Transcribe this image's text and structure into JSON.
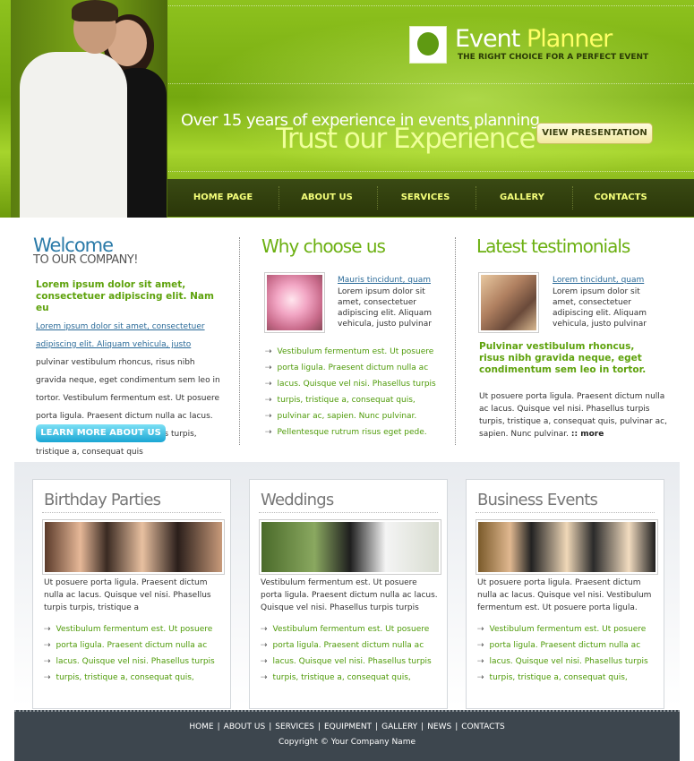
{
  "brand": {
    "title_a": "Event ",
    "title_b": "Planner",
    "tagline": "THE RIGHT CHOICE FOR A PERFECT EVENT"
  },
  "hero": {
    "line1": "Over 15 years of experience in events planning.",
    "line2": "Trust our Experience",
    "button": "VIEW PRESENTATION"
  },
  "nav": [
    "HOME PAGE",
    "ABOUT US",
    "SERVICES",
    "GALLERY",
    "CONTACTS"
  ],
  "welcome": {
    "title": "Welcome",
    "subtitle": "TO OUR COMPANY!",
    "lead": "Lorem ipsum dolor sit amet, consectetuer adipiscing elit. Nam eu",
    "link": "Lorem ipsum dolor sit amet, consectetuer adipiscing elit. Aliquam vehicula, justo",
    "body": "pulvinar vestibulum rhoncus, risus nibh gravida neque, eget condimentum sem leo in tortor. Vestibulum fermentum est. Ut posuere porta ligula. Praesent dictum nulla ac lacus. Quisque vel nisi. Phasellus turpis turpis, tristique a, consequat quis",
    "button": "LEARN MORE ABOUT US"
  },
  "why": {
    "title": "Why choose us",
    "link": "Mauris tincidunt, quam",
    "text": "Lorem ipsum dolor sit amet, consectetuer adipiscing elit. Aliquam vehicula, justo pulvinar",
    "bullets": [
      "Vestibulum fermentum est. Ut posuere",
      "porta ligula. Praesent dictum nulla ac",
      "lacus. Quisque vel nisi. Phasellus turpis",
      "turpis, tristique a, consequat quis,",
      "pulvinar ac, sapien. Nunc pulvinar.",
      "Pellentesque rutrum risus eget pede."
    ]
  },
  "testimonials": {
    "title": "Latest testimonials",
    "link": "Lorem tincidunt, quam",
    "text": "Lorem ipsum dolor sit amet, consectetuer adipiscing elit. Aliquam vehicula, justo pulvinar",
    "quote": "Pulvinar vestibulum rhoncus, risus nibh gravida neque, eget condimentum sem leo in tortor.",
    "body": "Ut posuere porta ligula. Praesent dictum nulla ac lacus. Quisque vel nisi. Phasellus turpis turpis, tristique a, consequat quis, pulvinar ac, sapien. Nunc pulvinar.",
    "more": ":: more"
  },
  "cards": [
    {
      "title": "Birthday Parties",
      "text": "Ut posuere porta ligula. Praesent dictum nulla ac lacus. Quisque vel nisi. Phasellus turpis turpis, tristique a",
      "bullets": [
        "Vestibulum fermentum est. Ut posuere",
        "porta ligula. Praesent dictum nulla ac",
        "lacus. Quisque vel nisi. Phasellus turpis",
        "turpis, tristique a, consequat quis,"
      ]
    },
    {
      "title": "Weddings",
      "text": "Vestibulum fermentum est. Ut posuere porta ligula. Praesent dictum nulla ac lacus. Quisque vel nisi. Phasellus turpis turpis",
      "bullets": [
        "Vestibulum fermentum est. Ut posuere",
        "porta ligula. Praesent dictum nulla ac",
        "lacus. Quisque vel nisi. Phasellus turpis",
        "turpis, tristique a, consequat quis,"
      ]
    },
    {
      "title": "Business Events",
      "text": "Ut posuere porta ligula. Praesent dictum nulla ac lacus. Quisque vel nisi. Vestibulum fermentum est. Ut posuere porta ligula.",
      "bullets": [
        "Vestibulum fermentum est. Ut posuere",
        "porta ligula. Praesent dictum nulla ac",
        "lacus. Quisque vel nisi. Phasellus turpis",
        "turpis, tristique a, consequat quis,"
      ]
    }
  ],
  "footer": {
    "links": [
      "HOME",
      "ABOUT US",
      "SERVICES",
      "EQUIPMENT",
      "GALLERY",
      "NEWS",
      "CONTACTS"
    ],
    "separator": "|",
    "copyright": "Copyright © Your Company Name"
  },
  "icons": {
    "bullet": "arrow-bullet-icon",
    "logo": "leaf-logo-icon"
  },
  "colors": {
    "brand_green": "#6cb012",
    "link_blue": "#2a6a98",
    "nav_text": "#f5ff7a",
    "footer_bg": "#3d464e"
  }
}
